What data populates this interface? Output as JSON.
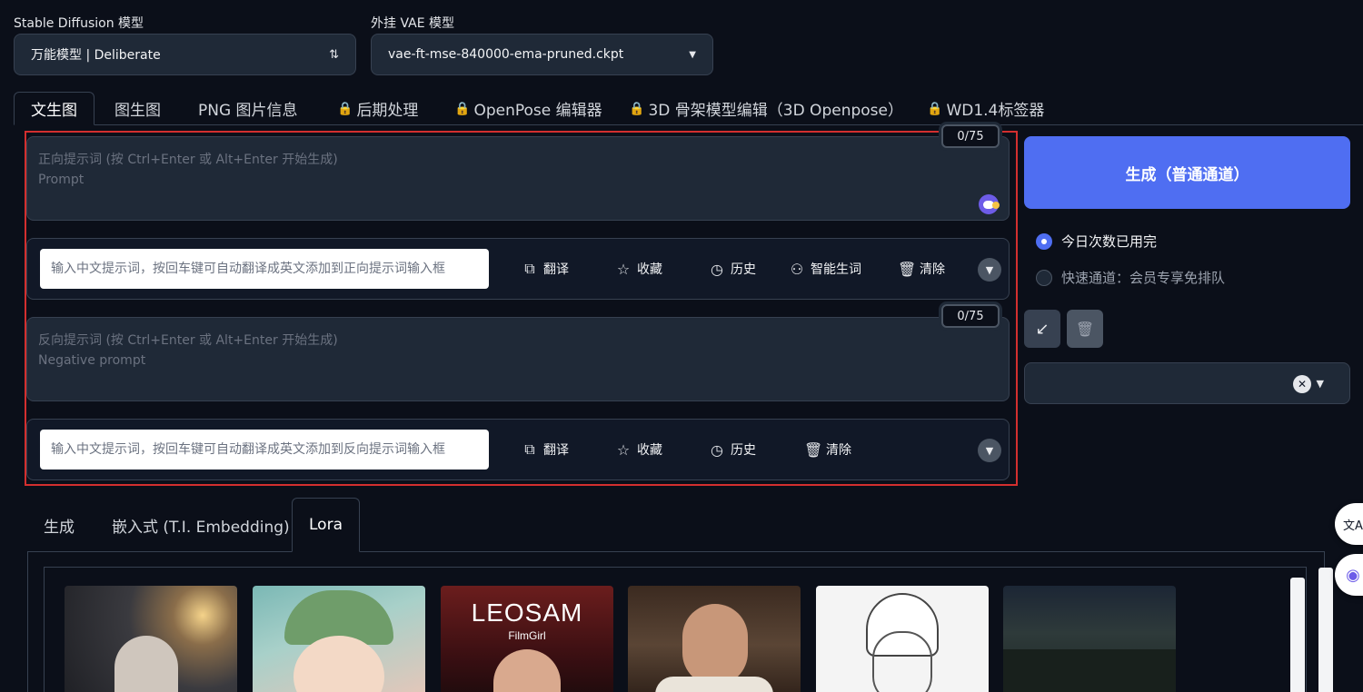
{
  "model": {
    "sd_label": "Stable Diffusion 模型",
    "sd_value": "万能模型 | Deliberate",
    "sd_arrow": "⇅",
    "vae_label": "外挂 VAE 模型",
    "vae_value": "vae-ft-mse-840000-ema-pruned.ckpt",
    "vae_arrow": "▼"
  },
  "tabs": [
    {
      "label": "文生图",
      "locked": false
    },
    {
      "label": "图生图",
      "locked": false
    },
    {
      "label": "PNG 图片信息",
      "locked": false
    },
    {
      "label": "后期处理",
      "locked": true
    },
    {
      "label": "OpenPose 编辑器",
      "locked": true
    },
    {
      "label": "3D 骨架模型编辑（3D Openpose）",
      "locked": true
    },
    {
      "label": "WD1.4标签器",
      "locked": true
    }
  ],
  "positive": {
    "placeholder_line1": "正向提示词 (按 Ctrl+Enter 或 Alt+Enter 开始生成)",
    "placeholder_line2": "Prompt",
    "counter": "0/75"
  },
  "positive_tools": {
    "input_placeholder": "输入中文提示词，按回车键可自动翻译成英文添加到正向提示词输入框",
    "translate": "翻译",
    "favorite": "收藏",
    "history": "历史",
    "smart": "智能生词",
    "clear": "清除"
  },
  "negative": {
    "placeholder_line1": "反向提示词 (按 Ctrl+Enter 或 Alt+Enter 开始生成)",
    "placeholder_line2": "Negative prompt",
    "counter": "0/75"
  },
  "negative_tools": {
    "input_placeholder": "输入中文提示词，按回车键可自动翻译成英文添加到反向提示词输入框",
    "translate": "翻译",
    "favorite": "收藏",
    "history": "历史",
    "clear": "清除"
  },
  "right_panel": {
    "generate": "生成（普通通道）",
    "option_daily": "今日次数已用完",
    "option_fast": "快速通道：会员专享免排队",
    "selected_option": "今日次数已用完"
  },
  "bottom_tabs": [
    {
      "label": "生成"
    },
    {
      "label": "嵌入式 (T.I. Embedding)"
    },
    {
      "label": "Lora"
    }
  ],
  "lora_cards": [
    {
      "theme": "mecha-girl",
      "caption": ""
    },
    {
      "theme": "anime-girl-headphones",
      "caption": ""
    },
    {
      "theme": "film-girl",
      "caption_main": "LEOSAM",
      "caption_sub": "FilmGirl"
    },
    {
      "theme": "man-portrait",
      "caption": ""
    },
    {
      "theme": "lineart-girl",
      "caption": ""
    },
    {
      "theme": "night-landscape",
      "caption": ""
    }
  ],
  "colors": {
    "background": "#0b0f19",
    "accent": "#4f6ef2",
    "highlight_frame": "#d32f2f",
    "lock": "#d9a441"
  }
}
